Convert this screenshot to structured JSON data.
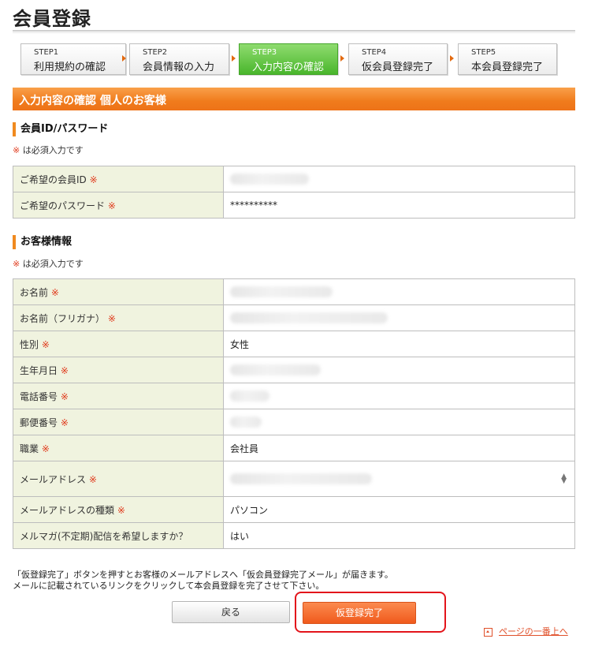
{
  "page": {
    "title": "会員登録"
  },
  "steps": [
    {
      "num": "STEP1",
      "label": "利用規約の確認"
    },
    {
      "num": "STEP2",
      "label": "会員情報の入力"
    },
    {
      "num": "STEP3",
      "label": "入力内容の確認",
      "active": true
    },
    {
      "num": "STEP4",
      "label": "仮会員登録完了"
    },
    {
      "num": "STEP5",
      "label": "本会員登録完了"
    }
  ],
  "section": {
    "title": "入力内容の確認 個人のお客様"
  },
  "account": {
    "heading": "会員ID/パスワード",
    "required_mark": "※",
    "required_note": " は必須入力です",
    "rows": [
      {
        "label": "ご希望の会員ID",
        "value": ""
      },
      {
        "label": "ご希望のパスワード",
        "value": "**********"
      }
    ]
  },
  "customer": {
    "heading": "お客様情報",
    "required_mark": "※",
    "required_note": " は必須入力です",
    "rows": [
      {
        "label": "お名前",
        "value": ""
      },
      {
        "label": "お名前（フリガナ）",
        "value": ""
      },
      {
        "label": "性別",
        "value": "女性"
      },
      {
        "label": "生年月日",
        "value": ""
      },
      {
        "label": "電話番号",
        "value": ""
      },
      {
        "label": "郵便番号",
        "value": ""
      },
      {
        "label": "職業",
        "value": "会社員"
      },
      {
        "label": "メールアドレス",
        "value": ""
      },
      {
        "label": "メールアドレスの種類",
        "value": "パソコン"
      },
      {
        "label": "メルマガ(不定期)配信を希望しますか？",
        "value": "はい"
      }
    ]
  },
  "req_mark": "※",
  "notice": {
    "line1": "「仮登録完了」ボタンを押すとお客様のメールアドレスへ「仮会員登録完了メール」が届きます。",
    "line2": "メールに記載されているリンクをクリックして本会員登録を完了させて下さい。"
  },
  "buttons": {
    "back": "戻る",
    "submit": "仮登録完了"
  },
  "top_link": "ページの一番上へ",
  "colors": {
    "accent": "#f07b1c",
    "active_step": "#49b62c",
    "highlight": "#e3141b"
  }
}
